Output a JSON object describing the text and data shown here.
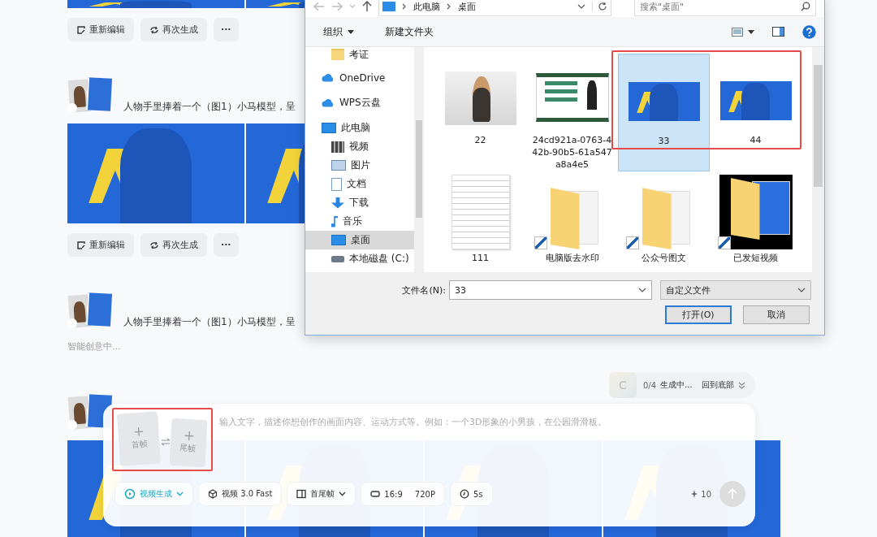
{
  "feed": [
    {
      "kind": "images"
    },
    {
      "kind": "actions",
      "buttons": [
        {
          "kind": "edit",
          "label": "重新编辑"
        },
        {
          "kind": "repeat",
          "label": "再次生成"
        },
        {
          "kind": "more",
          "label": "···"
        }
      ]
    },
    {
      "kind": "prompt",
      "text": "人物手里捧着一个（图1）小马模型，呈"
    },
    {
      "kind": "images"
    },
    {
      "kind": "actions",
      "buttons": [
        {
          "kind": "edit",
          "label": "重新编辑"
        },
        {
          "kind": "repeat",
          "label": "再次生成"
        },
        {
          "kind": "more",
          "label": "···"
        }
      ]
    },
    {
      "kind": "prompt",
      "text": "人物手里捧着一个（图1）小马模型，呈"
    },
    {
      "kind": "status",
      "text": "智能创意中..."
    },
    {
      "kind": "prompt"
    },
    {
      "kind": "images"
    }
  ],
  "progress": {
    "avatar": "C",
    "count": "0/4",
    "label": "生成中...",
    "link": "回到底部"
  },
  "composer": {
    "frames": [
      {
        "label": "首帧"
      },
      {
        "label": "尾帧"
      }
    ],
    "placeholder": "输入文字，描述你想创作的画面内容、运动方式等。例如：一个3D形象的小男孩，在公园滑滑板。",
    "options": [
      {
        "kind": "video",
        "label": "视频生成",
        "selected": true,
        "dropdown": true
      },
      {
        "kind": "cube",
        "label": "视频 3.0 Fast",
        "selected": false,
        "dropdown": false
      },
      {
        "kind": "frames",
        "label": "首尾帧",
        "selected": false,
        "dropdown": true
      },
      {
        "kind": "ratio",
        "label": "16:9",
        "extra": "720P",
        "selected": false,
        "dropdown": false
      },
      {
        "kind": "clock",
        "label": "5s",
        "selected": false,
        "dropdown": false
      }
    ],
    "credits": "10"
  },
  "dialog": {
    "path": [
      "此电脑",
      "桌面"
    ],
    "search_placeholder": "搜索\"桌面\"",
    "toolbar": {
      "organize": "组织",
      "new_folder": "新建文件夹"
    },
    "nav": [
      {
        "kind": "folder",
        "label": "考证",
        "selected": false
      },
      {
        "kind": "cloud",
        "label": "OneDrive",
        "selected": false
      },
      {
        "kind": "cloud",
        "label": "WPS云盘",
        "selected": false
      },
      {
        "kind": "pc",
        "label": "此电脑",
        "selected": false,
        "children": [
          {
            "kind": "video",
            "label": "视频",
            "selected": false
          },
          {
            "kind": "picture",
            "label": "图片",
            "selected": false
          },
          {
            "kind": "document",
            "label": "文档",
            "selected": false
          },
          {
            "kind": "download",
            "label": "下载",
            "selected": false
          },
          {
            "kind": "music",
            "label": "音乐",
            "selected": false
          },
          {
            "kind": "desktop",
            "label": "桌面",
            "selected": true
          },
          {
            "kind": "disk",
            "label": "本地磁盘 (C:)",
            "selected": false
          }
        ]
      }
    ],
    "files": [
      {
        "kind": "horse",
        "name": "22",
        "selected": false,
        "shortcut": false,
        "marked": false
      },
      {
        "kind": "slide",
        "name": "24cd921a-0763-442b-90b5-61a547a8a4e5",
        "selected": false,
        "shortcut": false,
        "marked": false
      },
      {
        "kind": "poster",
        "name": "33",
        "selected": true,
        "shortcut": false,
        "marked": true
      },
      {
        "kind": "poster",
        "name": "44",
        "selected": false,
        "shortcut": false,
        "marked": true
      },
      {
        "kind": "document",
        "name": "111",
        "selected": false,
        "shortcut": false,
        "marked": false
      },
      {
        "kind": "folder",
        "name": "电脑版去水印",
        "selected": false,
        "shortcut": true,
        "marked": false
      },
      {
        "kind": "folder",
        "name": "公众号图文",
        "selected": false,
        "shortcut": true,
        "marked": false
      },
      {
        "kind": "folder-dark",
        "name": "已发短视频",
        "selected": false,
        "shortcut": true,
        "marked": false
      }
    ],
    "filename_label": "文件名(N):",
    "filename": "33",
    "filetype": "自定义文件",
    "buttons": [
      {
        "label": "打开(O)",
        "default": true
      },
      {
        "label": "取消",
        "default": false
      }
    ]
  }
}
